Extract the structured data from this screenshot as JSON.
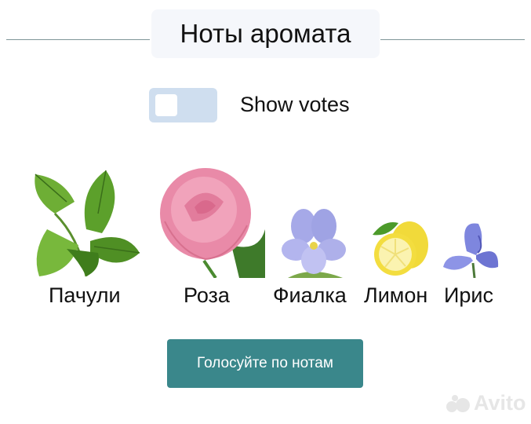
{
  "header": {
    "title": "Ноты аромата"
  },
  "toggle": {
    "label": "Show votes",
    "checked": false
  },
  "notes": [
    {
      "label": "Пачули",
      "icon": "patchouli-image"
    },
    {
      "label": "Роза",
      "icon": "rose-image"
    },
    {
      "label": "Фиалка",
      "icon": "violet-image"
    },
    {
      "label": "Лимон",
      "icon": "lemon-image"
    },
    {
      "label": "Ирис",
      "icon": "iris-image"
    }
  ],
  "action": {
    "vote_label": "Голосуйте по нотам"
  },
  "watermark": {
    "text": "Avito"
  },
  "colors": {
    "button": "#3a878b",
    "toggle_track": "#cfdeef",
    "title_bg": "#f5f7fb"
  }
}
